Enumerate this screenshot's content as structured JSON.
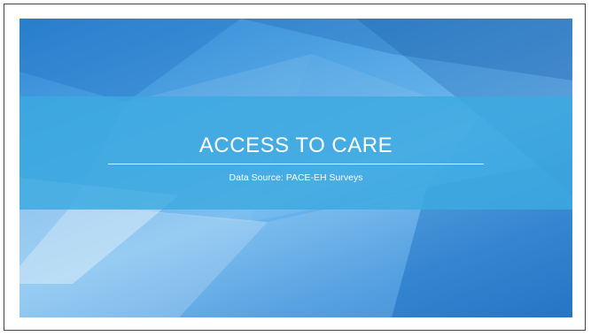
{
  "slide": {
    "title": "ACCESS TO CARE",
    "subtitle": "Data Source:  PACE-EH Surveys"
  },
  "colors": {
    "banner": "#3caae1",
    "background_dark": "#2a7ccc",
    "background_light": "#6fb8ee",
    "text": "#ffffff"
  }
}
